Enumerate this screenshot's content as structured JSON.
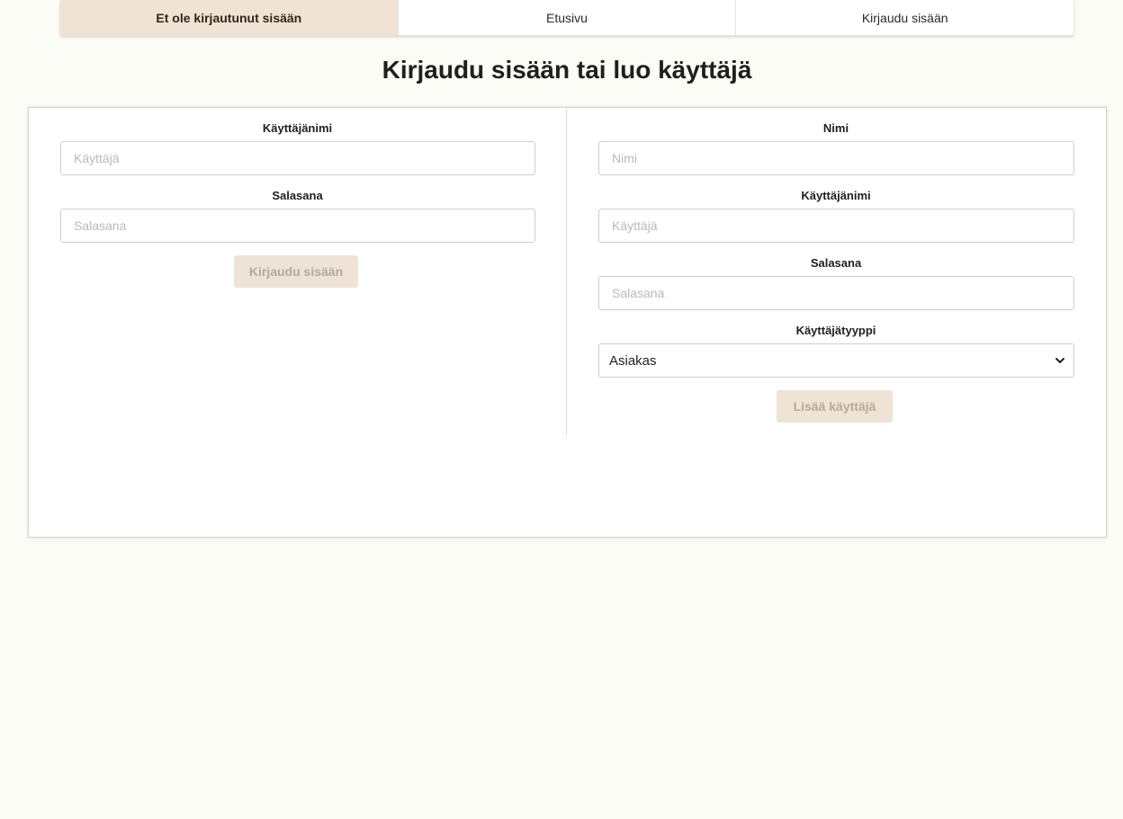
{
  "nav": {
    "status": "Et ole kirjautunut sisään",
    "home": "Etusivu",
    "login": "Kirjaudu sisään"
  },
  "page_title": "Kirjaudu sisään tai luo käyttäjä",
  "login_form": {
    "username_label": "Käyttäjänimi",
    "username_placeholder": "Käyttäjä",
    "password_label": "Salasana",
    "password_placeholder": "Salasana",
    "submit_label": "Kirjaudu sisään"
  },
  "register_form": {
    "name_label": "Nimi",
    "name_placeholder": "Nimi",
    "username_label": "Käyttäjänimi",
    "username_placeholder": "Käyttäjä",
    "password_label": "Salasana",
    "password_placeholder": "Salasana",
    "user_type_label": "Käyttäjätyyppi",
    "user_type_selected": "Asiakas",
    "submit_label": "Lisää käyttäjä"
  },
  "icons": {
    "select_arrow": "chevron-down-icon"
  },
  "colors": {
    "background": "#fcfcf6",
    "accent": "#f0e3d4",
    "button_text_disabled": "#b6a99a"
  }
}
